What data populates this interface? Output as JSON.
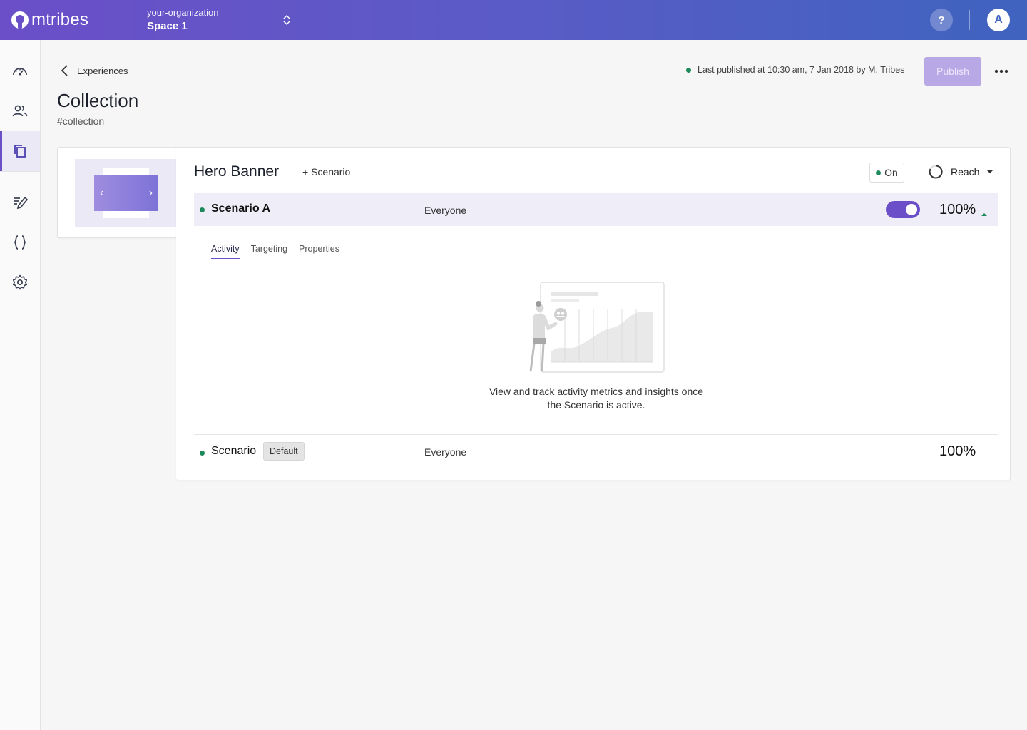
{
  "brand": {
    "name": "mtribes",
    "primary": "#6b4fc8",
    "accent": "#3f63bf",
    "status_green": "#1e8a5b"
  },
  "topbar": {
    "organization": "your-organization",
    "space": "Space 1",
    "help_label": "?",
    "avatar_initial": "A"
  },
  "sidebar": {
    "items": [
      {
        "name": "dashboard",
        "icon": "speedometer-icon",
        "active": false
      },
      {
        "name": "audience",
        "icon": "people-icon",
        "active": false
      },
      {
        "name": "experiences",
        "icon": "copy-icon",
        "active": true
      },
      {
        "name": "edit",
        "icon": "edit-icon",
        "active": false
      },
      {
        "name": "code",
        "icon": "braces-icon",
        "active": false
      },
      {
        "name": "settings",
        "icon": "gear-icon",
        "active": false
      }
    ]
  },
  "header": {
    "breadcrumb": "Experiences",
    "title": "Collection",
    "key": "#collection",
    "publish_status": "Last published at 10:30 am, 7 Jan 2018 by M. Tribes",
    "publish_label": "Publish"
  },
  "experience": {
    "title": "Hero Banner",
    "add_scenario_label": "+ Scenario",
    "state_label": "On",
    "reach_label": "Reach",
    "scenarios": [
      {
        "name": "Scenario A",
        "audience": "Everyone",
        "enabled": true,
        "percent": "100%"
      },
      {
        "name": "Scenario",
        "tag": "Default",
        "audience": "Everyone",
        "percent": "100%"
      }
    ],
    "tabs": [
      "Activity",
      "Targeting",
      "Properties"
    ],
    "active_tab": "Activity",
    "empty_message": "View and track activity metrics and insights once the Scenario is active."
  }
}
